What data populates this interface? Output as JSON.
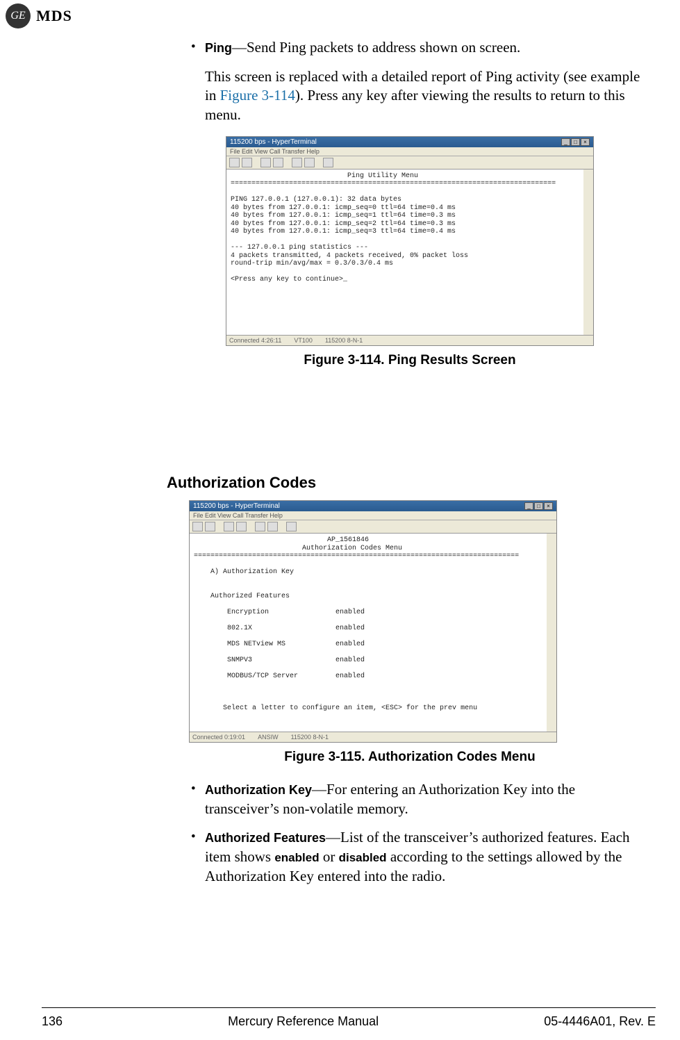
{
  "header": {
    "ge": "GE",
    "mds": "MDS"
  },
  "body": {
    "bullet_ping_label": "Ping",
    "bullet_ping_desc": "—Send Ping packets to address shown on screen.",
    "ping_body_1": "This screen is replaced with a detailed report of Ping activity (see example in ",
    "ping_body_link": "Figure 3-114",
    "ping_body_2": "). Press any key after viewing the results to return to this menu."
  },
  "fig114": {
    "title": "115200 bps - HyperTerminal",
    "menubar": "File   Edit   View   Call   Transfer   Help",
    "heading": "Ping Utility Menu",
    "sep": "==============================================================================",
    "lines": [
      "PING 127.0.0.1 (127.0.0.1): 32 data bytes",
      "40 bytes from 127.0.0.1: icmp_seq=0 ttl=64 time=0.4 ms",
      "40 bytes from 127.0.0.1: icmp_seq=1 ttl=64 time=0.3 ms",
      "40 bytes from 127.0.0.1: icmp_seq=2 ttl=64 time=0.3 ms",
      "40 bytes from 127.0.0.1: icmp_seq=3 ttl=64 time=0.4 ms",
      "",
      "--- 127.0.0.1 ping statistics ---",
      "4 packets transmitted, 4 packets received, 0% packet loss",
      "round-trip min/avg/max = 0.3/0.3/0.4 ms",
      "",
      "<Press any key to continue>_"
    ],
    "status": [
      "Connected 4:26:11",
      "VT100",
      "115200 8-N-1"
    ],
    "caption": "Figure 3-114. Ping Results Screen"
  },
  "section_heading": "Authorization Codes",
  "fig115": {
    "title": "115200 bps - HyperTerminal",
    "menubar": "File   Edit   View   Call   Transfer   Help",
    "ap_line": "AP_1561846",
    "heading": "Authorization Codes Menu",
    "sep": "==============================================================================",
    "authkey": "A) Authorization Key",
    "features_heading": "Authorized Features",
    "features": [
      {
        "name": "Encryption",
        "value": "enabled"
      },
      {
        "name": "802.1X",
        "value": "enabled"
      },
      {
        "name": "MDS NETview MS",
        "value": "enabled"
      },
      {
        "name": "SNMPV3",
        "value": "enabled"
      },
      {
        "name": "MODBUS/TCP Server",
        "value": "enabled"
      }
    ],
    "footer_msg": "Select a letter to configure an item, <ESC> for the prev menu",
    "status": [
      "Connected 0:19:01",
      "ANSIW",
      "115200 8-N-1"
    ],
    "caption": "Figure 3-115. Authorization Codes Menu"
  },
  "after": {
    "bullet1_label": "Authorization Key",
    "bullet1_desc": "—For entering an Authorization Key into the transceiver’s non-volatile memory.",
    "bullet2_label": "Authorized Features",
    "bullet2_desc_a": "—List of the transceiver’s authorized features. Each item shows ",
    "enabled": "enabled",
    "or": " or ",
    "disabled": "disabled",
    "bullet2_desc_b": " according to the settings allowed by the Authorization Key entered into the radio."
  },
  "footer": {
    "page": "136",
    "center": "Mercury Reference Manual",
    "right": "05-4446A01, Rev. E"
  }
}
